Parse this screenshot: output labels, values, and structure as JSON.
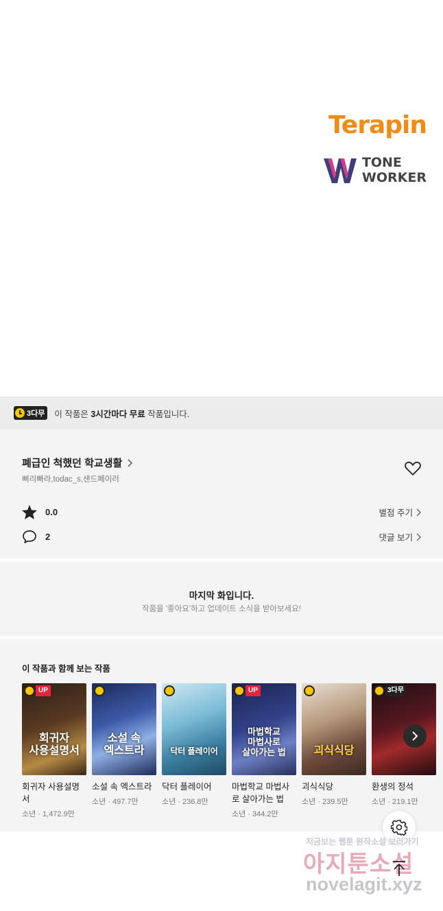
{
  "logos": {
    "terapin": "Terapin",
    "toneworker_line1": "TONE",
    "toneworker_line2": "WORKER"
  },
  "free_banner": {
    "badge": "3다무",
    "prefix": "이 작품은 ",
    "highlight": "3시간마다 무료",
    "suffix": " 작품입니다."
  },
  "work": {
    "title": "폐급인 척했던 학교생활",
    "authors": "삐리빠라,todac_s,샌드페이러",
    "rating": "0.0",
    "rate_label": "별점 주기",
    "comments": "2",
    "comments_label": "댓글 보기"
  },
  "last_episode": {
    "title": "마지막 화입니다.",
    "subtitle": "작품을 '좋아요'하고 업데이트 소식을 받아보세요!"
  },
  "recommendations": {
    "heading": "이 작품과 함께 보는 작품",
    "items": [
      {
        "name": "회귀자 사용설명서",
        "meta": "소년 · 1,472.9만",
        "badge": "UP",
        "cover": "회귀자\n사용설명서"
      },
      {
        "name": "소설 속 엑스트라",
        "meta": "소년 · 497.7만",
        "badge": "",
        "cover": "소설 속\n엑스트라"
      },
      {
        "name": "닥터 플레이어",
        "meta": "소년 · 236.8만",
        "badge": "",
        "cover": "닥터 플레이어"
      },
      {
        "name": "마법학교 마법사로 살아가는 법",
        "meta": "소년 · 344.2만",
        "badge": "UP",
        "cover": "마법학교\n마법사로\n살아가는 법"
      },
      {
        "name": "괴식식당",
        "meta": "소년 · 239.5만",
        "badge": "",
        "cover": "괴식식당"
      },
      {
        "name": "환생의 정석",
        "meta": "소년 · 219.1만",
        "badge": "3다무",
        "cover": ""
      }
    ]
  },
  "watermark": {
    "line1": "지금보는 웹툰 원작소설 보러가기",
    "line2": "아지툰소설",
    "line3": "novelagit.xyz"
  },
  "colors": {
    "brand_orange": "#f28c18",
    "badge_yellow": "#f7c600",
    "up_red": "#e8233b"
  }
}
